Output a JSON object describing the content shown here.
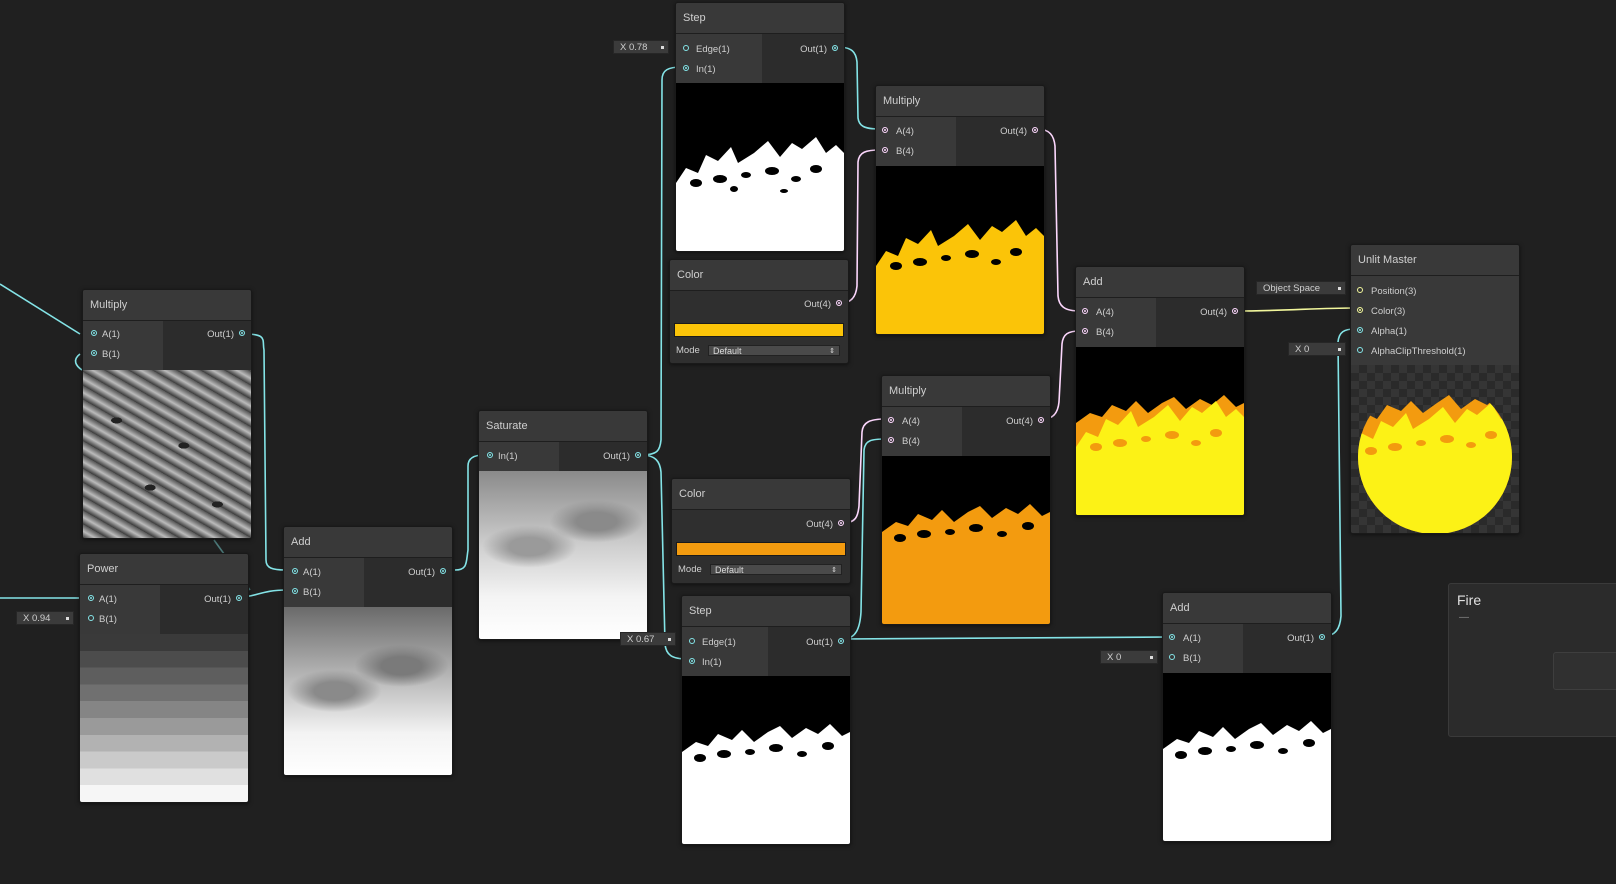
{
  "wire_colors": {
    "float": "#84e4e7",
    "vector4": "#fcd7fd",
    "vector3": "#f2f79c"
  },
  "nodes": {
    "multiply_a": {
      "title": "Multiply",
      "in": [
        "A(1)",
        "B(1)"
      ],
      "out": "Out(1)"
    },
    "power": {
      "title": "Power",
      "in": [
        "A(1)",
        "B(1)"
      ],
      "out": "Out(1)",
      "b_value": "X  0.94"
    },
    "add_a": {
      "title": "Add",
      "in": [
        "A(1)",
        "B(1)"
      ],
      "out": "Out(1)"
    },
    "saturate": {
      "title": "Saturate",
      "in": [
        "In(1)"
      ],
      "out": "Out(1)"
    },
    "step_top": {
      "title": "Step",
      "in": [
        "Edge(1)",
        "In(1)"
      ],
      "out": "Out(1)",
      "edge_value": "X  0.78"
    },
    "color_yellow": {
      "title": "Color",
      "out": "Out(4)",
      "swatch": "#fbc408",
      "mode_label": "Mode",
      "mode_value": "Default"
    },
    "color_orange": {
      "title": "Color",
      "out": "Out(4)",
      "swatch": "#f39b0f",
      "mode_label": "Mode",
      "mode_value": "Default"
    },
    "step_bottom": {
      "title": "Step",
      "in": [
        "Edge(1)",
        "In(1)"
      ],
      "out": "Out(1)",
      "edge_value": "X  0.67"
    },
    "multiply_top": {
      "title": "Multiply",
      "in": [
        "A(4)",
        "B(4)"
      ],
      "out": "Out(4)"
    },
    "multiply_bottom": {
      "title": "Multiply",
      "in": [
        "A(4)",
        "B(4)"
      ],
      "out": "Out(4)"
    },
    "add_color": {
      "title": "Add",
      "in": [
        "A(4)",
        "B(4)"
      ],
      "out": "Out(4)"
    },
    "add_alpha": {
      "title": "Add",
      "in": [
        "A(1)",
        "B(1)"
      ],
      "out": "Out(1)",
      "b_value": "X  0"
    },
    "unlit_master": {
      "title": "Unlit Master",
      "in": [
        "Position(3)",
        "Color(3)",
        "Alpha(1)",
        "AlphaClipThreshold(1)"
      ],
      "position_value": "Object Space",
      "clip_value": "X  0"
    }
  },
  "blackboard": {
    "title": "Fire",
    "subtitle": "—"
  }
}
